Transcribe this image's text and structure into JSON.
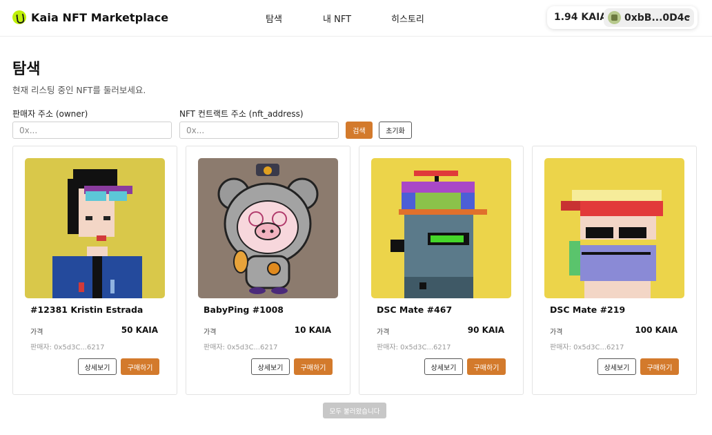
{
  "header": {
    "brand": "Kaia NFT Marketplace",
    "nav": {
      "explore": "탐색",
      "my_nft": "내 NFT",
      "history": "히스토리"
    },
    "wallet": {
      "balance": "1.94 KAIA",
      "address": "0xbB...0D4c",
      "chevron": "⌄"
    }
  },
  "page": {
    "title": "탐색",
    "subtitle": "현재 리스팅 중인 NFT를 둘러보세요."
  },
  "filters": {
    "owner_label": "판매자 주소 (owner)",
    "owner_placeholder": "0x...",
    "nft_label": "NFT 컨트랙트 주소 (nft_address)",
    "nft_placeholder": "0x...",
    "search": "검색",
    "reset": "초기화"
  },
  "listings": [
    {
      "name": "#12381 Kristin Estrada",
      "price_label": "가격",
      "price": "50 KAIA",
      "seller": "판매자: 0x5d3C...6217",
      "detail": "상세보기",
      "buy": "구매하기"
    },
    {
      "name": "BabyPing #1008",
      "price_label": "가격",
      "price": "10 KAIA",
      "seller": "판매자: 0x5d3C...6217",
      "detail": "상세보기",
      "buy": "구매하기"
    },
    {
      "name": "DSC Mate #467",
      "price_label": "가격",
      "price": "90 KAIA",
      "seller": "판매자: 0x5d3C...6217",
      "detail": "상세보기",
      "buy": "구매하기"
    },
    {
      "name": "DSC Mate #219",
      "price_label": "가격",
      "price": "100 KAIA",
      "seller": "판매자: 0x5d3C...6217",
      "detail": "상세보기",
      "buy": "구매하기"
    }
  ],
  "load_all": "모두 불러왔습니다",
  "colors": {
    "accent": "#d37a2c",
    "brand_logo": "#bff009",
    "disabled": "#c7c7c7"
  }
}
